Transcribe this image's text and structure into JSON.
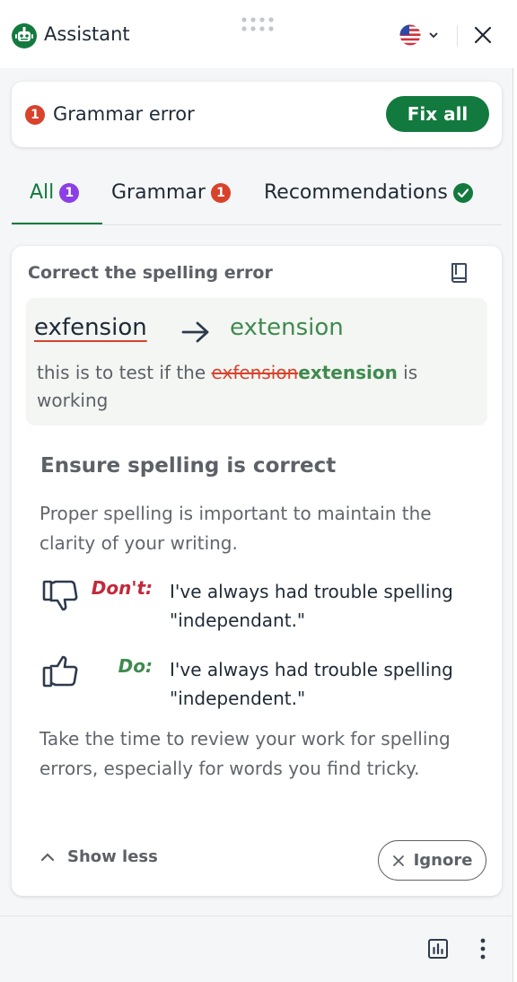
{
  "header": {
    "app_title": "Assistant",
    "logo_icon": "robot-icon",
    "language_flag": "us-flag-icon",
    "close_icon": "close-icon"
  },
  "error_bar": {
    "count": "1",
    "label": "Grammar error",
    "fix_all_label": "Fix all"
  },
  "tabs": [
    {
      "label": "All",
      "badge": "1",
      "badge_color": "#8b3fe6",
      "active": true
    },
    {
      "label": "Grammar",
      "badge": "1",
      "badge_color": "#d9422b",
      "active": false
    },
    {
      "label": "Recommendations",
      "badge_icon": "check-icon",
      "badge_color": "#127a3e",
      "active": false
    }
  ],
  "card": {
    "title": "Correct the spelling error",
    "wrong_word": "exfension",
    "right_word": "extension",
    "sentence_prefix": "this is to test if the ",
    "sentence_wrong": "exfension",
    "sentence_fix": "extension",
    "sentence_suffix": " is working",
    "explain_title": "Ensure spelling is correct",
    "explain_text": "Proper spelling is important to maintain the clarity of your writing.",
    "dont_label": "Don't:",
    "dont_text": "I've always had trouble spelling \"independant.\"",
    "do_label": "Do:",
    "do_text": "I've always had trouble spelling \"independent.\"",
    "tip_text": "Take the time to review your work for spelling errors, especially for words you find tricky.",
    "show_less_label": "Show less",
    "ignore_label": "Ignore"
  },
  "colors": {
    "brand_green": "#127a3e",
    "error_red": "#d9422b",
    "all_badge_purple": "#8b3fe6"
  }
}
